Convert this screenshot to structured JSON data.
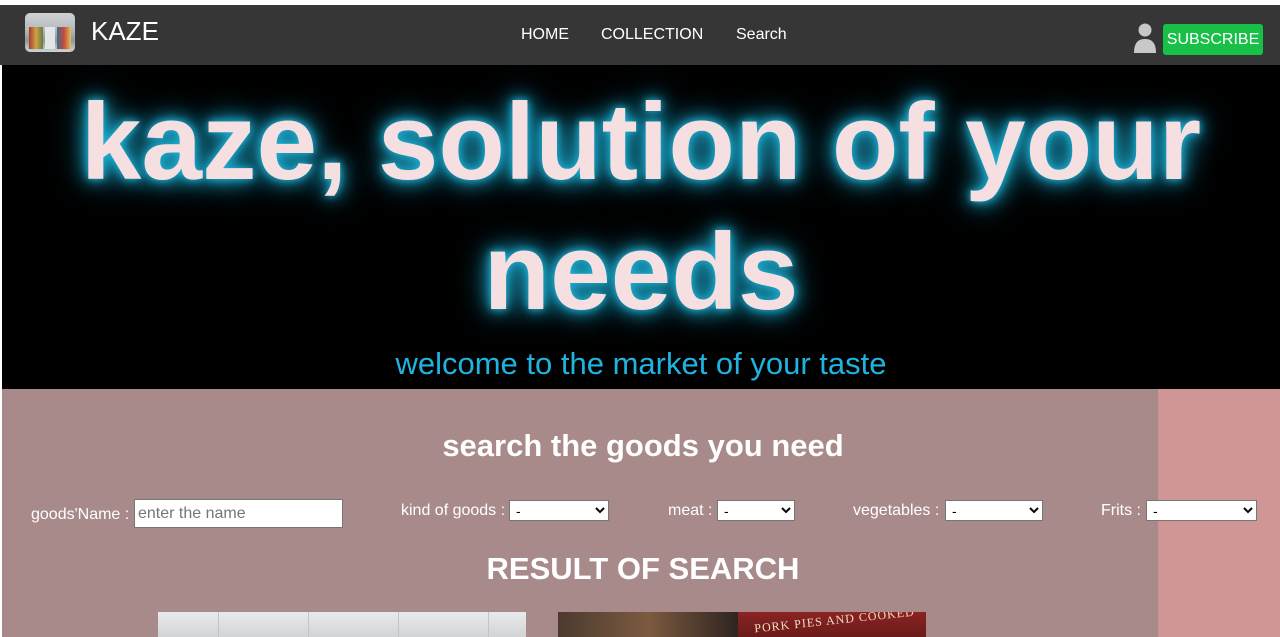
{
  "navbar": {
    "brand": "KAZE",
    "links": [
      "HOME",
      "COLLECTION",
      "Search"
    ],
    "subscribe_label": "SUBSCRIBE",
    "icons": {
      "logo": "supermarket-aisle-logo",
      "user": "user-icon"
    },
    "colors": {
      "background": "#363636",
      "subscribe": "#19c048"
    }
  },
  "hero": {
    "title": "kaze, solution of your needs",
    "subtitle": "welcome to the market of your taste",
    "colors": {
      "title": "#f6dfe1",
      "glow": "#1eb4d8",
      "subtitle": "#1fb3df",
      "background": "#000000"
    }
  },
  "search": {
    "heading": "search the goods you need",
    "name_label": "goods'Name :",
    "name_placeholder": "enter the name",
    "name_value": "",
    "filters": [
      {
        "label": "kind of goods :",
        "selected": "-"
      },
      {
        "label": "meat :",
        "selected": "-"
      },
      {
        "label": "vegetables :",
        "selected": "-"
      },
      {
        "label": "Frits :",
        "selected": "-"
      }
    ],
    "colors": {
      "panel": "#a98a8b",
      "right_strip": "#d09595"
    }
  },
  "results": {
    "heading": "RESULT OF SEARCH",
    "items": [
      {
        "image": "store-ceiling-photo"
      },
      {
        "image": "pork-pies-shop-photo",
        "sign_text": "PORK  PIES  AND  COOKED"
      }
    ]
  }
}
